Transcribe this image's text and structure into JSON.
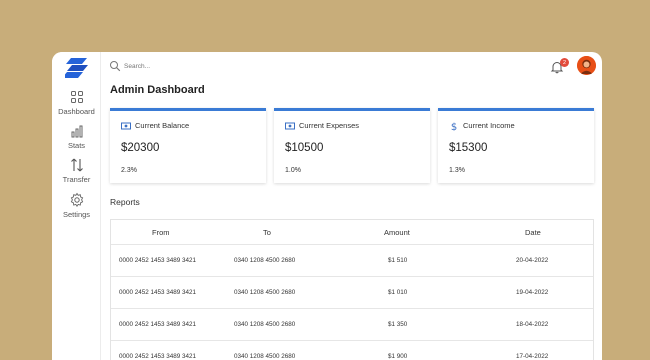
{
  "sidebar": {
    "items": [
      {
        "label": "Dashboard",
        "icon": "grid-icon"
      },
      {
        "label": "Stats",
        "icon": "bar-chart-icon"
      },
      {
        "label": "Transfer",
        "icon": "transfer-arrows-icon"
      },
      {
        "label": "Settings",
        "icon": "gear-icon"
      }
    ]
  },
  "topbar": {
    "search_placeholder": "Search...",
    "notification_count": "2"
  },
  "page": {
    "title": "Admin Dashboard"
  },
  "cards": [
    {
      "title": "Current Balance",
      "value": "$20300",
      "percent": "2.3%",
      "icon": "money-icon"
    },
    {
      "title": "Current Expenses",
      "value": "$10500",
      "percent": "1.0%",
      "icon": "money-icon"
    },
    {
      "title": "Current Income",
      "value": "$15300",
      "percent": "1.3%",
      "icon": "dollar-icon"
    }
  ],
  "reports": {
    "title": "Reports",
    "columns": [
      "From",
      "To",
      "Amount",
      "Date"
    ],
    "rows": [
      [
        "0000 2452 1453 3489 3421",
        "0340 1208 4500 2680",
        "$1 510",
        "20-04-2022"
      ],
      [
        "0000 2452 1453 3489 3421",
        "0340 1208 4500 2680",
        "$1 010",
        "19-04-2022"
      ],
      [
        "0000 2452 1453 3489 3421",
        "0340 1208 4500 2680",
        "$1 350",
        "18-04-2022"
      ],
      [
        "0000 2452 1453 3489 3421",
        "0340 1208 4500 2680",
        "$1 900",
        "17-04-2022"
      ]
    ]
  },
  "colors": {
    "background": "#c8ad7a",
    "accent": "#3a7bd5",
    "badge": "#e24b3b"
  }
}
